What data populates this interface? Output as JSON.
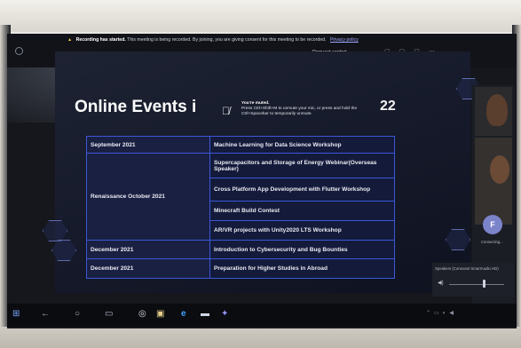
{
  "teams_bar": {
    "request_control": "Request control"
  },
  "banner": {
    "bold": "Recording has started.",
    "text": "This meeting is being recorded. By joining, you are giving consent for this meeting to be recorded.",
    "link": "Privacy policy"
  },
  "slide": {
    "title": "Online Events i",
    "page_number": "22"
  },
  "mute_toast": {
    "title": "You're muted.",
    "body": "Press Ctrl+Shift+M to unmute your mic, or press and hold the Ctrl+Spacebar to temporarily unmute."
  },
  "events": [
    {
      "date": "September 2021",
      "event": "Machine Learning for Data Science Workshop"
    },
    {
      "date": "Renaissance October 2021",
      "event": "Supercapacitors and Storage of Energy Webinar(Overseas Speaker)"
    },
    {
      "date": "",
      "event": "Cross Platform App Development with Flutter Workshop"
    },
    {
      "date": "",
      "event": "Minecraft Build Contest"
    },
    {
      "date": "",
      "event": "AR/VR projects with Unity2020 LTS Workshop"
    },
    {
      "date": "December 2021",
      "event": "Introduction to Cybersecurity and Bug Bounties"
    },
    {
      "date": "December 2021",
      "event": "Preparation for Higher Studies in Abroad"
    }
  ],
  "participants": {
    "avatar_initial": "F",
    "connecting": "Connecting..."
  },
  "speaker": {
    "label": "Speakers (Conexant SmartAudio HD)",
    "volume": 0.62
  },
  "icons": {
    "start": "windows-start-icon",
    "edge": "edge-icon",
    "teams": "teams-icon",
    "mute": "mic-muted-icon"
  }
}
